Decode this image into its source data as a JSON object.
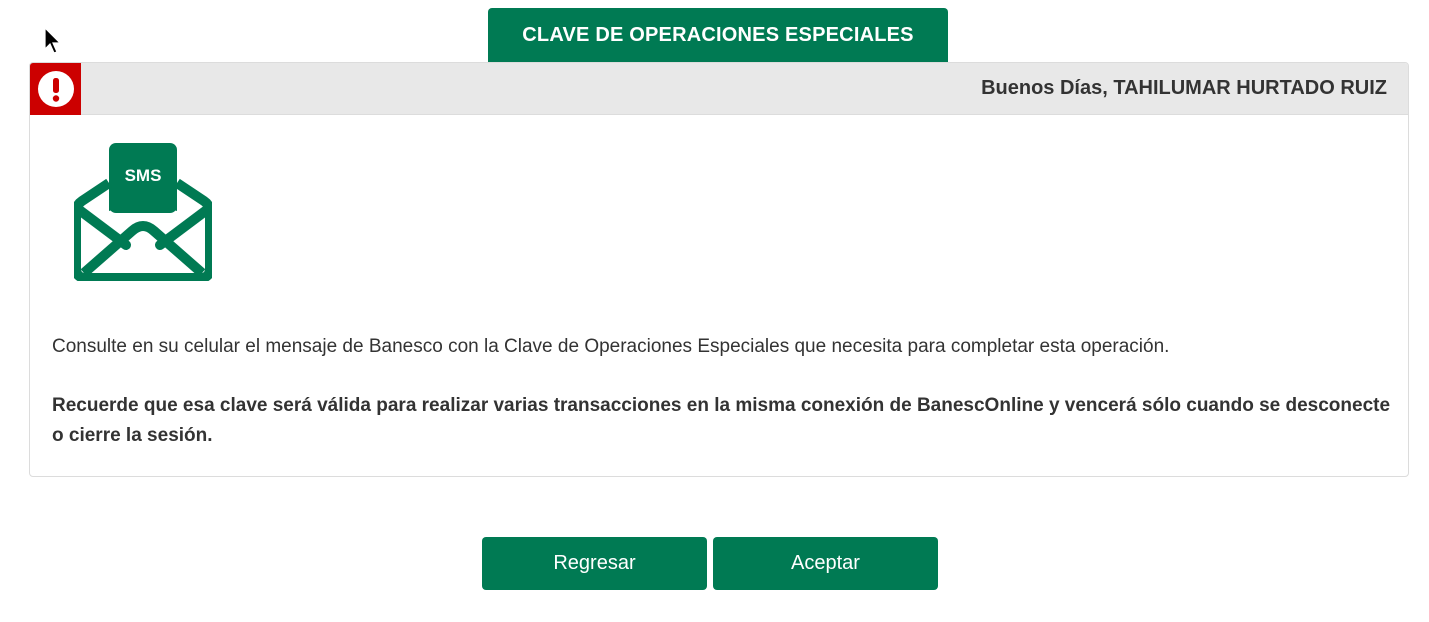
{
  "page_title": "CLAVE DE OPERACIONES ESPECIALES",
  "panel": {
    "greeting": "Buenos Días, TAHILUMAR HURTADO RUIZ",
    "alert_icon": "exclamation-circle-icon",
    "sms_icon_label": "SMS",
    "message": "Consulte en su celular el mensaje de Banesco con la Clave de Operaciones Especiales que necesita para completar esta operación.",
    "message_bold": "Recuerde que esa clave será válida para realizar varias transacciones en la misma conexión de BanescOnline y vencerá sólo cuando se desconecte o cierre la sesión."
  },
  "buttons": {
    "back_label": "Regresar",
    "accept_label": "Aceptar"
  },
  "colors": {
    "brand_green": "#007a53",
    "alert_red": "#cc0000",
    "header_gray": "#e8e8e8"
  }
}
